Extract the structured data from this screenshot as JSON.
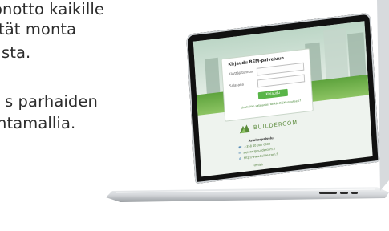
{
  "marketing": {
    "lines": [
      "önotto kaikille",
      "tät monta",
      "sta.",
      "s parhaiden",
      "ntamallia."
    ]
  },
  "screen": {
    "login_title": "Kirjaudu BEM-palveluun",
    "username_label": "Käyttäjätunnus",
    "password_label": "Salasana",
    "login_button": "Kirjaudu",
    "forgot_link": "Unohditko salasanasi tai käyttäjätunnuksesi?",
    "brand": "BUILDERCOM",
    "contact_title": "Asiakaspalvelu",
    "phone": "+358 40 000 0000",
    "email": "support@buildercom.fi",
    "website": "http://www.buildercom.fi",
    "language": "Finnish"
  },
  "colors": {
    "accent_green": "#59b548",
    "brand_text": "#5a8a3a"
  }
}
